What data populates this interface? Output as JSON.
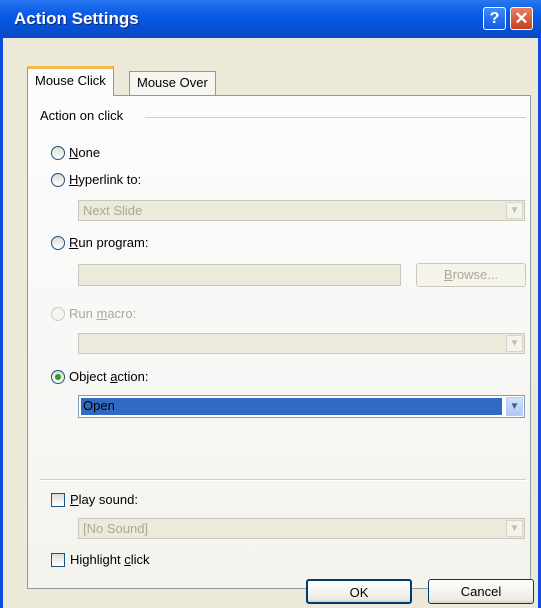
{
  "window": {
    "title": "Action Settings",
    "help_glyph": "?",
    "close_glyph": "✕"
  },
  "tabs": [
    {
      "label": "Mouse Click",
      "active": true
    },
    {
      "label": "Mouse Over",
      "active": false
    }
  ],
  "group": {
    "label": "Action on click"
  },
  "options": {
    "none": {
      "prefix": "",
      "key": "N",
      "rest": "one",
      "selected": false
    },
    "hyperlink": {
      "prefix": "",
      "key": "H",
      "rest": "yperlink to:",
      "selected": false
    },
    "run_program": {
      "prefix": "",
      "key": "R",
      "rest": "un program:",
      "selected": false
    },
    "run_macro": {
      "prefix": "Run ",
      "key": "m",
      "rest": "acro:",
      "selected": false,
      "disabled": true
    },
    "object_action": {
      "prefix": "Object ",
      "key": "a",
      "rest": "ction:",
      "selected": true
    }
  },
  "hyperlink_combo": {
    "value": "Next Slide"
  },
  "run_program_text": {
    "value": ""
  },
  "browse_button": {
    "prefix": "",
    "key": "B",
    "rest": "rowse..."
  },
  "macro_combo": {
    "value": ""
  },
  "object_action_combo": {
    "value": "Open"
  },
  "play_sound": {
    "prefix": "",
    "key": "P",
    "rest": "lay sound:",
    "checked": false
  },
  "sound_combo": {
    "value": "[No Sound]"
  },
  "highlight_click": {
    "prefix": "Highlight ",
    "key": "c",
    "rest": "lick",
    "checked": false
  },
  "footer": {
    "ok_label": "OK",
    "cancel_label": "Cancel"
  },
  "colors": {
    "titlebar": "#0a5ce8",
    "dialog_bg": "#ece9d8",
    "tab_highlight": "#f7b74a",
    "selection": "#316ac5",
    "radio_dot": "#21a121"
  },
  "icons": {
    "combo_arrow": "chevron-down-icon",
    "help": "question-icon",
    "close": "close-icon"
  }
}
